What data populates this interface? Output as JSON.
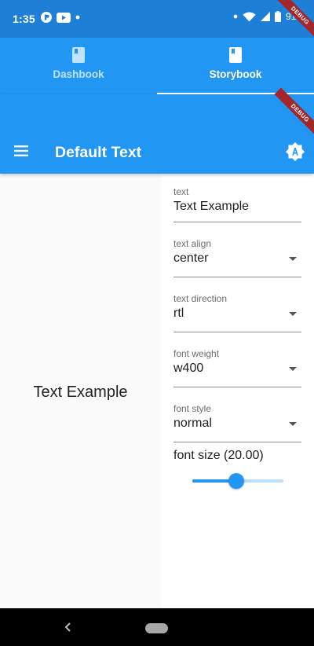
{
  "status_bar": {
    "time": "1:35",
    "battery": "91%",
    "color": "#1e7fd6"
  },
  "tabs": [
    {
      "label": "Dashbook",
      "icon": "book-icon",
      "active": false
    },
    {
      "label": "Storybook",
      "icon": "book-icon",
      "active": true
    }
  ],
  "app_bar": {
    "title": "Default Text",
    "menu_icon": "menu-icon",
    "action_icon": "brightness-auto-icon"
  },
  "debug_banner": "DEBUG",
  "preview": {
    "text": "Text Example"
  },
  "knobs": {
    "text": {
      "label": "text",
      "value": "Text Example"
    },
    "text_align": {
      "label": "text align",
      "value": "center"
    },
    "text_direction": {
      "label": "text direction",
      "value": "rtl"
    },
    "font_weight": {
      "label": "font weight",
      "value": "w400"
    },
    "font_style": {
      "label": "font style",
      "value": "normal"
    },
    "font_size": {
      "label": "font size (20.00)",
      "value": 20.0,
      "slider_fraction": 0.48
    }
  },
  "colors": {
    "primary": "#2196f3",
    "status_bar": "#1e7fd6",
    "debug_ribbon": "#a3262b"
  }
}
